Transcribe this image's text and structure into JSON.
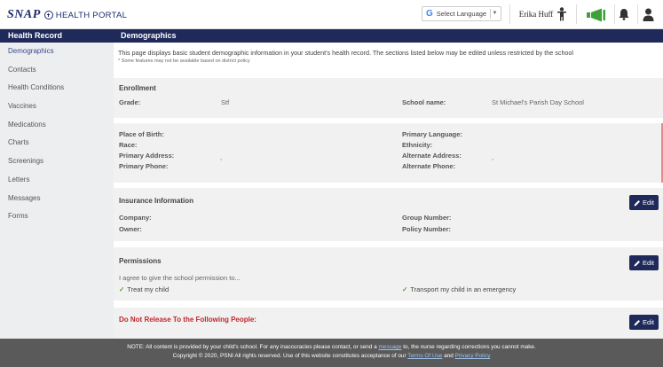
{
  "header": {
    "logo_snap": "SNAP",
    "logo_text": "HEALTH PORTAL",
    "language_label": "Select Language",
    "user_name": "Erika Huff"
  },
  "sidebar": {
    "title": "Health Record",
    "items": [
      {
        "label": "Demographics"
      },
      {
        "label": "Contacts"
      },
      {
        "label": "Health Conditions"
      },
      {
        "label": "Vaccines"
      },
      {
        "label": "Medications"
      },
      {
        "label": "Charts"
      },
      {
        "label": "Screenings"
      },
      {
        "label": "Letters"
      },
      {
        "label": "Messages"
      },
      {
        "label": "Forms"
      }
    ]
  },
  "main": {
    "title": "Demographics",
    "intro": "This page displays basic student demographic information in your student's health record. The sections listed below may be edited unless restricted by the school",
    "note": "* Some features may not be available based on district policy",
    "enrollment": {
      "title": "Enrollment",
      "grade_label": "Grade:",
      "grade_value": "Stf",
      "school_label": "School name:",
      "school_value": "St Michael's Parish Day School"
    },
    "personal": {
      "place_of_birth": "Place of Birth:",
      "race": "Race:",
      "primary_address": "Primary Address:",
      "primary_address_value": ",",
      "primary_phone": "Primary Phone:",
      "primary_language": "Primary Language:",
      "ethnicity": "Ethnicity:",
      "alternate_address": "Alternate Address:",
      "alternate_address_value": ",",
      "alternate_phone": "Alternate Phone:"
    },
    "insurance": {
      "title": "Insurance Information",
      "company": "Company:",
      "owner": "Owner:",
      "group_number": "Group Number:",
      "policy_number": "Policy Number:",
      "edit_label": "Edit"
    },
    "permissions": {
      "title": "Permissions",
      "description": "I agree to give the school permission to...",
      "treat": "Treat my child",
      "transport": "Transport my child in an emergency",
      "edit_label": "Edit"
    },
    "do_not_release": {
      "title": "Do Not Release To the Following People:",
      "edit_label": "Edit"
    }
  },
  "footer": {
    "line1_a": "NOTE: All content is provided by your child's school. For any inaccuracies please contact, or send a",
    "line1_link": "message",
    "line1_b": "to, the nurse regarding corrections you cannot make.",
    "line2_a": "Copyright © 2020, PSNI All rights reserved. Use of this website constitutes acceptance of our",
    "terms_link": "Terms Of Use",
    "and": "and",
    "privacy_link": "Privacy Policy"
  },
  "colors": {
    "navy": "#1f2a5b",
    "red_title": "#c0272d",
    "green_check": "#5a9e3a",
    "megaphone_green": "#3fa03a"
  },
  "icons": [
    "plus-circle-icon",
    "google-g-icon",
    "child-icon",
    "megaphone-icon",
    "bell-icon",
    "person-icon",
    "pencil-icon",
    "checkmark-icon"
  ]
}
